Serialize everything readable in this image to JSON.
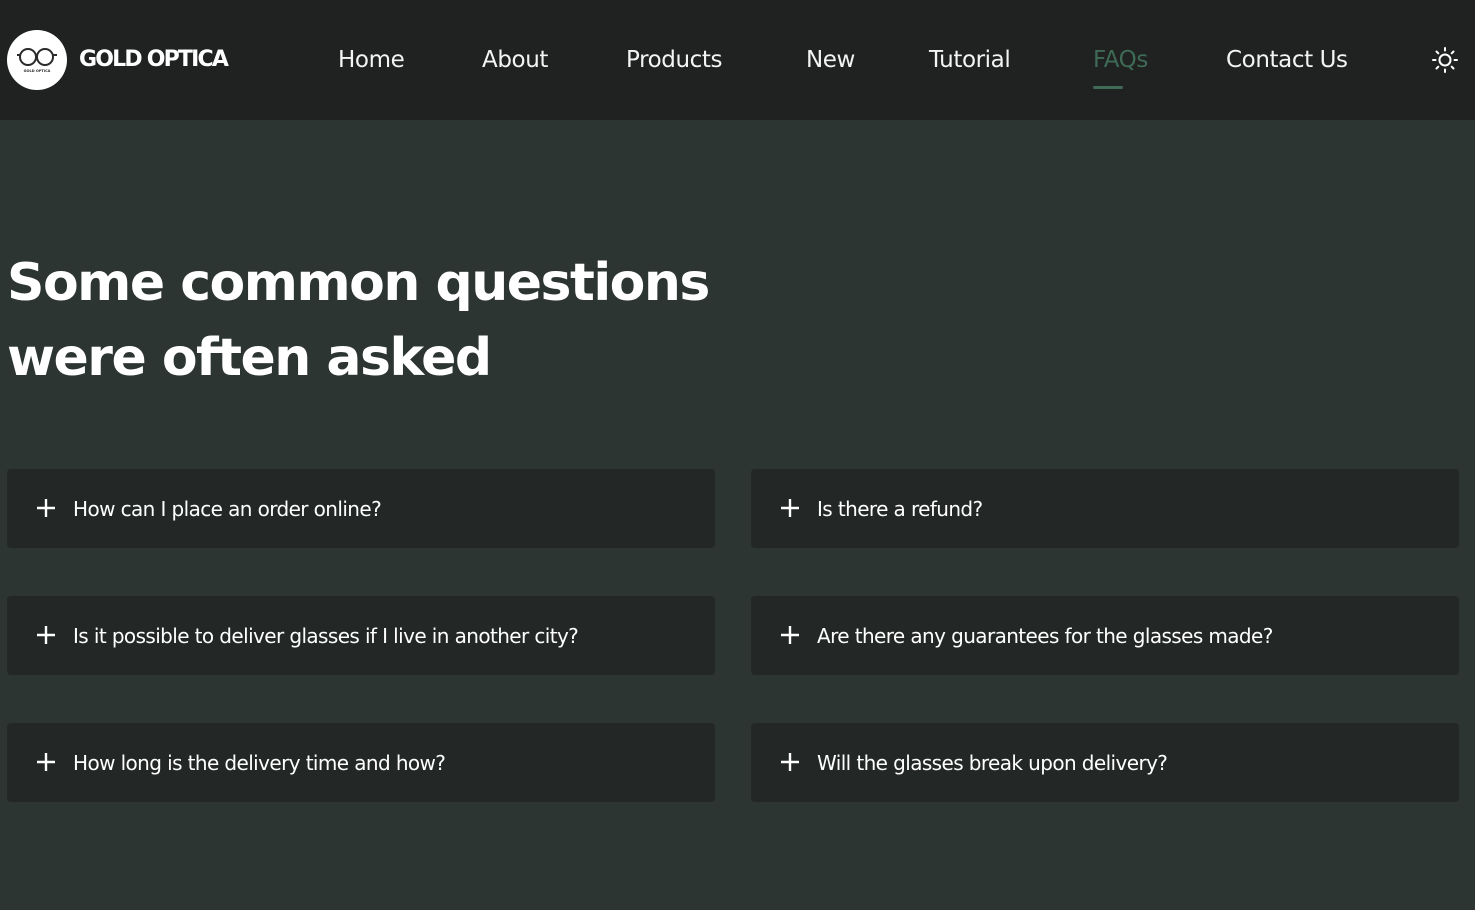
{
  "brand": {
    "name": "GOLD OPTICA",
    "logo_text": "GOLD OPTICA"
  },
  "nav": {
    "items": [
      {
        "label": "Home"
      },
      {
        "label": "About"
      },
      {
        "label": "Products"
      },
      {
        "label": "New"
      },
      {
        "label": "Tutorial"
      },
      {
        "label": "FAQs",
        "active": true
      },
      {
        "label": "Contact Us"
      }
    ],
    "theme_toggle_icon": "sun-icon"
  },
  "hero": {
    "title_line1": "Some common questions",
    "title_line2": "were often asked"
  },
  "faqs": [
    {
      "question": "How can I place an order online?"
    },
    {
      "question": "Is there a refund?"
    },
    {
      "question": "Is it possible to deliver glasses if I live in another city?"
    },
    {
      "question": "Are there any guarantees for the glasses made?"
    },
    {
      "question": "How long is the delivery time and how?"
    },
    {
      "question": "Will the glasses break upon delivery?"
    }
  ],
  "colors": {
    "background": "#2d3532",
    "navbar": "#1f2221",
    "card": "#232827",
    "accent": "#3e6a56",
    "text": "#ffffff"
  },
  "icons": {
    "expand": "plus-icon",
    "logo": "glasses-logo-icon"
  }
}
